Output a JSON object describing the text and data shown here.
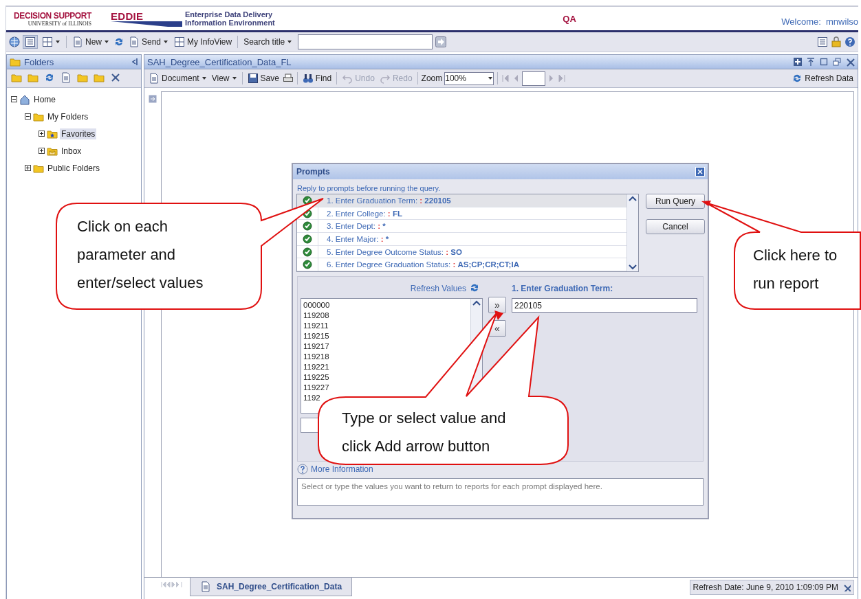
{
  "header": {
    "logo_title": "DECISION SUPPORT",
    "logo_subtitle": "UNIVERSITY of ILLINOIS",
    "eddie": "EDDIE",
    "eddie_line1": "Enterprise Data Delivery",
    "eddie_line2": "Information Environment",
    "environment": "QA",
    "welcome": "Welcome:  mnwilso"
  },
  "toolbar": {
    "new": "New",
    "send": "Send",
    "my_infoview": "My InfoView",
    "search_scope": "Search title"
  },
  "folders": {
    "title": "Folders",
    "tree": [
      {
        "label": "Home",
        "kind": "home",
        "expanded": true,
        "selected": false,
        "children": [
          {
            "label": "My Folders",
            "kind": "folder",
            "expanded": true,
            "selected": false,
            "children": [
              {
                "label": "Favorites",
                "kind": "favorites",
                "expanded": false,
                "selected": true
              },
              {
                "label": "Inbox",
                "kind": "inbox",
                "expanded": false,
                "selected": false
              }
            ]
          },
          {
            "label": "Public Folders",
            "kind": "folder",
            "expanded": false,
            "selected": false
          }
        ]
      }
    ]
  },
  "document": {
    "title": "SAH_Degree_Certification_Data_FL",
    "toolbar": {
      "document": "Document",
      "view": "View",
      "save": "Save",
      "find": "Find",
      "undo": {
        "label": "Undo",
        "disabled": true
      },
      "redo": {
        "label": "Redo",
        "disabled": true
      },
      "zoom_label": "Zoom",
      "zoom_value": "100%",
      "refresh": "Refresh Data"
    },
    "tab": "SAH_Degree_Certification_Data",
    "refresh_date": "Refresh Date: June 9, 2010 1:09:09 PM"
  },
  "dialog": {
    "title": "Prompts",
    "instruction": "Reply to prompts before running the query.",
    "prompts": [
      {
        "label": "1. Enter Graduation Term:",
        "separator": ":",
        "value": "220105",
        "selected": true
      },
      {
        "label": "2. Enter College:",
        "separator": ":",
        "value": "FL",
        "selected": false
      },
      {
        "label": "3. Enter Dept:",
        "separator": ":",
        "value": "*",
        "selected": false
      },
      {
        "label": "4. Enter Major:",
        "separator": ":",
        "value": "*",
        "selected": false
      },
      {
        "label": "5. Enter Degree Outcome Status:",
        "separator": ":",
        "value": "SO",
        "selected": false
      },
      {
        "label": "6. Enter Degree Graduation Status:",
        "separator": ":",
        "value": "AS;CP;CR;CT;IA",
        "selected": false
      }
    ],
    "buttons": [
      "Run Query",
      "Cancel"
    ],
    "refresh_values": "Refresh Values",
    "current_prompt": "1. Enter Graduation Term:",
    "values": [
      "000000",
      "119208",
      "119211",
      "119215",
      "119217",
      "119218",
      "119221",
      "119225",
      "119227",
      "1192"
    ],
    "add": "»",
    "remove": "«",
    "entered_value": "220105",
    "more_info": "More Information",
    "description": "Select or type the values you want to return to reports for each prompt displayed here."
  },
  "callouts": [
    "Click on each parameter and enter/select values",
    "Click here to run report",
    "Type or select value and click Add arrow button"
  ]
}
